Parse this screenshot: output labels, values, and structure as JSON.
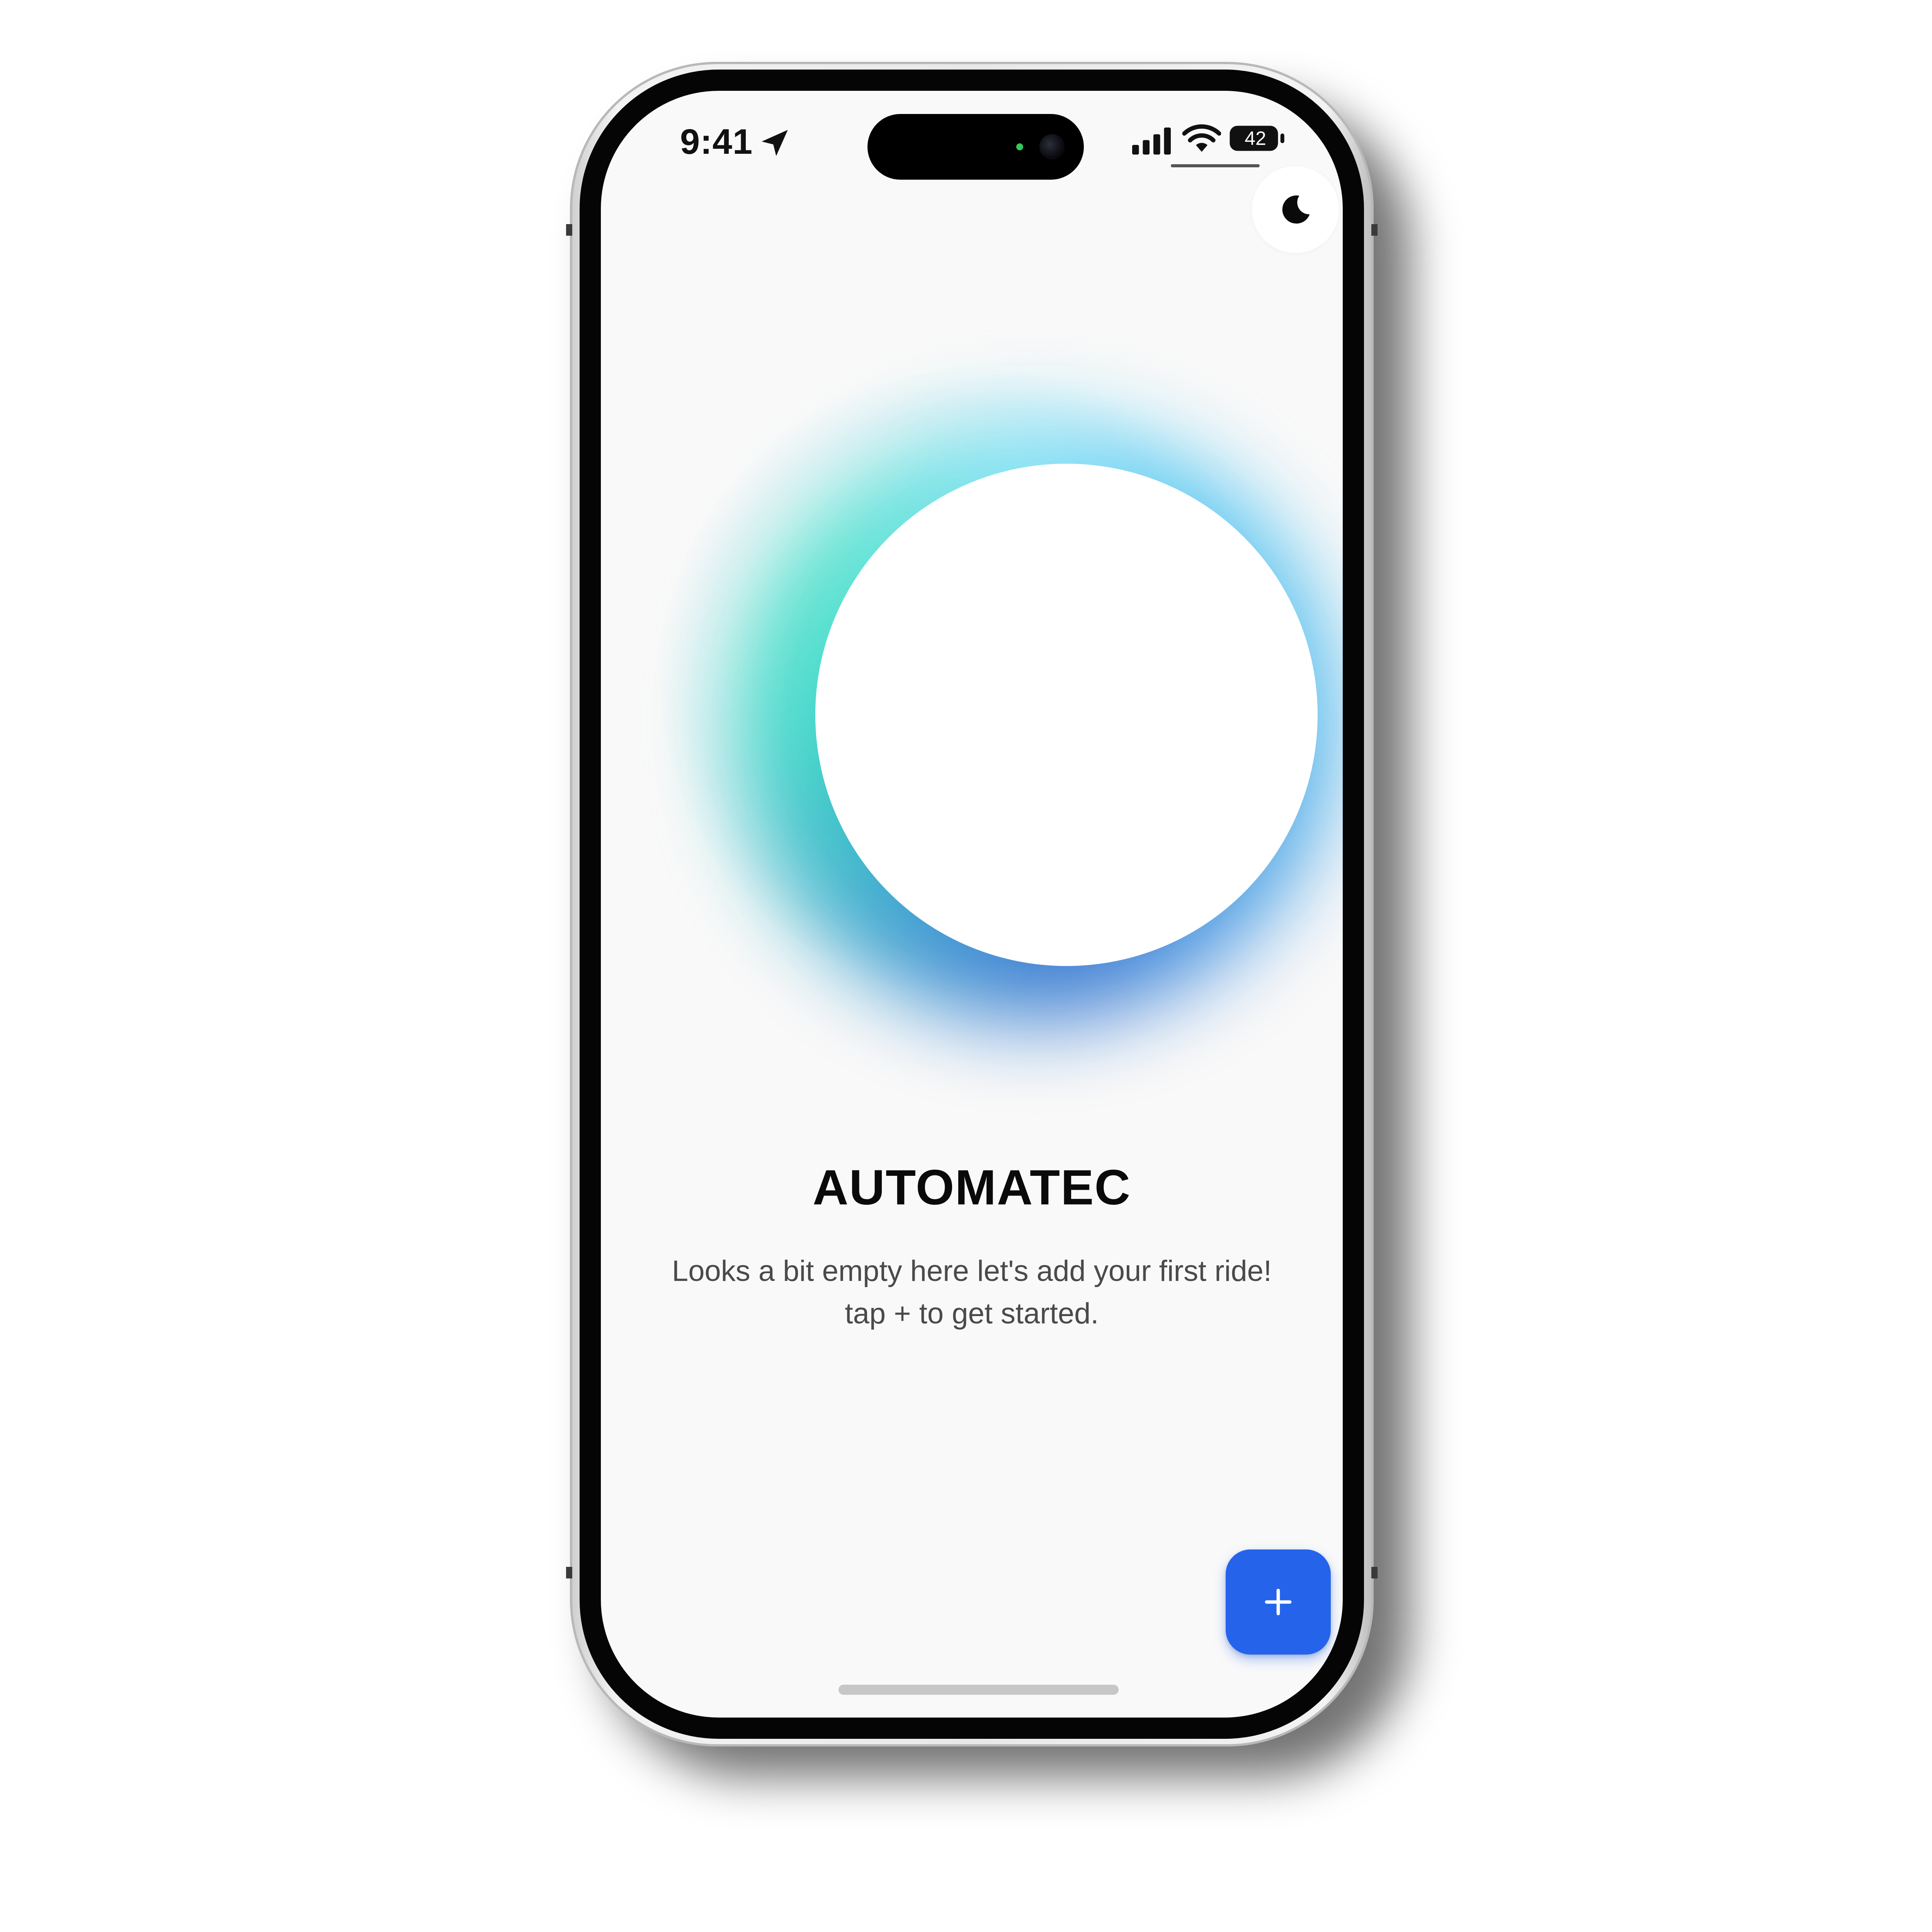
{
  "status_bar": {
    "time": "9:41",
    "battery_level": "42",
    "icons": [
      "location-arrow-icon",
      "signal-icon",
      "wifi-icon",
      "battery-icon"
    ]
  },
  "header": {
    "theme_toggle_icon": "moon-icon"
  },
  "main": {
    "title": "AUTOMATEC",
    "message_line1": "Looks a bit empty here let's add your first ride!",
    "message_line2": "tap + to get started."
  },
  "fab": {
    "icon": "plus-icon",
    "color": "#2563eb"
  },
  "colors": {
    "background": "#f9f9f9",
    "glow_teal": "#3ed8c8",
    "glow_blue": "#3a8fe0",
    "accent": "#2563eb"
  }
}
